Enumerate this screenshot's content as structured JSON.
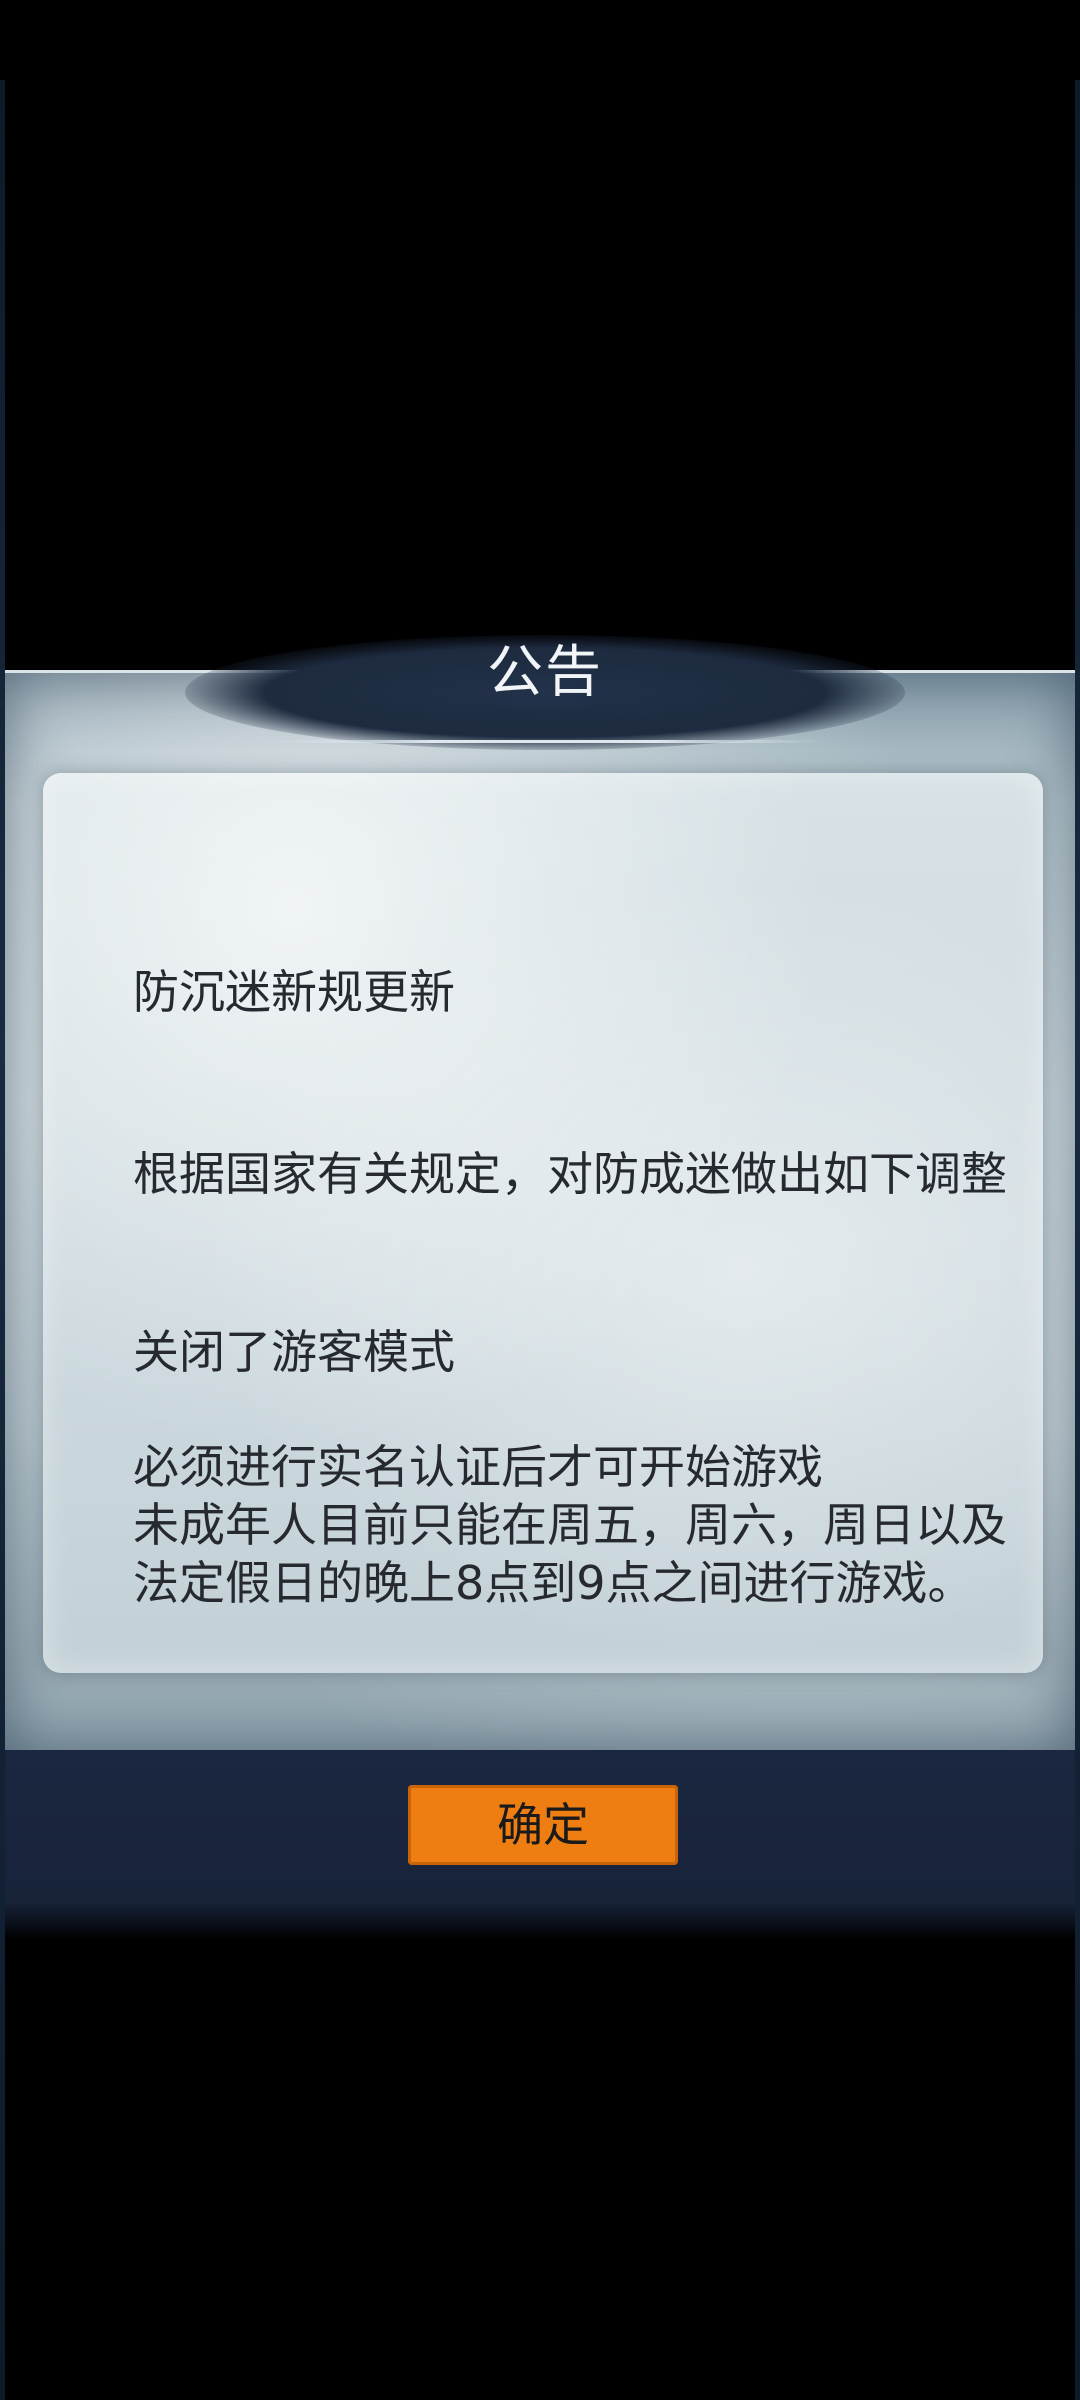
{
  "dialog": {
    "title": "公告",
    "heading": "防沉迷新规更新",
    "paragraph1": "根据国家有关规定，对防成迷做出如下调整",
    "paragraph2": "关闭了游客模式",
    "paragraph3_line1": "必须进行实名认证后才可开始游戏",
    "paragraph3_line2": "未成年人目前只能在周五，周六，周日以及法定假日的晚上8点到9点之间进行游戏。"
  },
  "footer": {
    "confirm_label": "确定"
  },
  "colors": {
    "button": "#ee7d12",
    "bar": "#1b2740",
    "text": "#262a30"
  }
}
